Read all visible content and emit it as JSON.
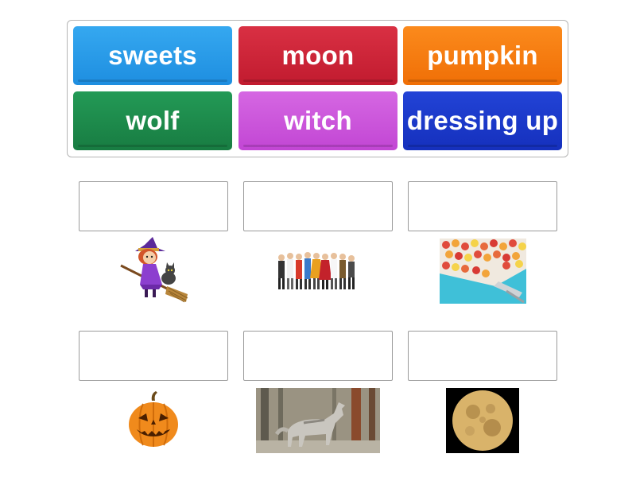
{
  "word_bank": {
    "tiles": [
      {
        "label": "sweets",
        "color": "#1e8ee0"
      },
      {
        "label": "moon",
        "color": "#c11b2f"
      },
      {
        "label": "pumpkin",
        "color": "#f06f06"
      },
      {
        "label": "wolf",
        "color": "#187c42"
      },
      {
        "label": "witch",
        "color": "#c246d4"
      },
      {
        "label": "dressing up",
        "color": "#1530bd"
      }
    ]
  },
  "match_items": [
    {
      "image": "witch-on-broom-image"
    },
    {
      "image": "costumed-children-image"
    },
    {
      "image": "candy-sweets-image"
    },
    {
      "image": "jack-o-lantern-image"
    },
    {
      "image": "howling-wolf-image"
    },
    {
      "image": "full-moon-image"
    }
  ]
}
